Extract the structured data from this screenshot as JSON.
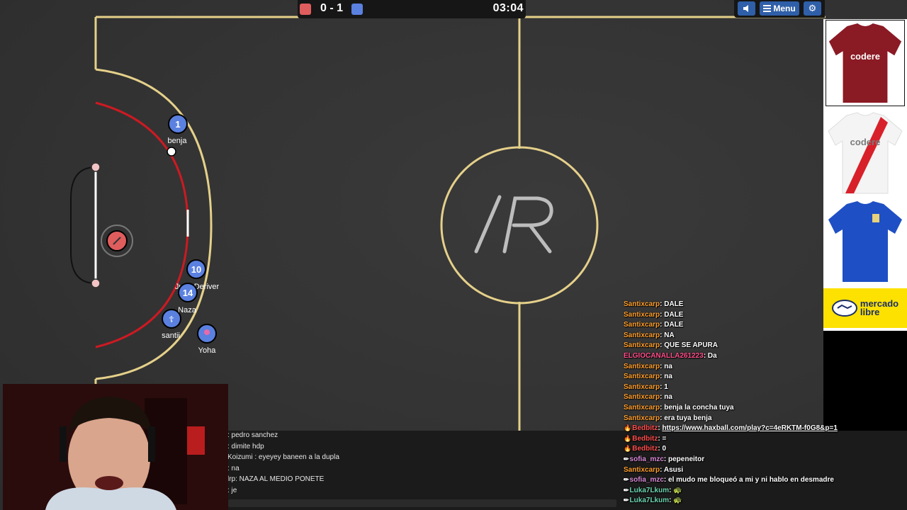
{
  "scoreboard": {
    "score": "0 - 1",
    "timer": "03:04",
    "red_color": "#e05d5d",
    "blue_color": "#5a80e0"
  },
  "top_menu": {
    "sound_icon": "speaker-icon",
    "menu_label": "Menu",
    "menu_icon": "hamburger-icon",
    "settings_icon": "gear-icon"
  },
  "field": {
    "center_logo": "/R"
  },
  "players": [
    {
      "team": "blue",
      "number": "1",
      "name": "benja"
    },
    {
      "team": "blue",
      "number": "10",
      "name": "Juan Deriver"
    },
    {
      "team": "blue",
      "number": "14",
      "name": "Naza"
    },
    {
      "team": "blue",
      "number": "",
      "name": "santii"
    },
    {
      "team": "blue",
      "number": "",
      "name": "Yoha"
    },
    {
      "team": "red",
      "number": "",
      "name": ""
    }
  ],
  "sponsors": {
    "brand": "mercado\nlibre",
    "jersey_text": "codere"
  },
  "game_chat": [
    {
      "text": ": pedro sanchez"
    },
    {
      "text": ": dimite hdp"
    },
    {
      "text": "Koizumi : eyeyey baneen a la dupla"
    },
    {
      "text": ": na"
    },
    {
      "text": "lrp: NAZA AL MEDIO PONETE"
    },
    {
      "text": ": je"
    }
  ],
  "stream_chat": [
    {
      "user": "Santixcarp",
      "msg": "DALE",
      "color": "#ff9f2e",
      "badge": ""
    },
    {
      "user": "Santixcarp",
      "msg": "DALE",
      "color": "#ff9f2e",
      "badge": ""
    },
    {
      "user": "Santixcarp",
      "msg": "DALE",
      "color": "#ff9f2e",
      "badge": ""
    },
    {
      "user": "Santixcarp",
      "msg": "NA",
      "color": "#ff9f2e",
      "badge": ""
    },
    {
      "user": "Santixcarp",
      "msg": "QUE SE APURA",
      "color": "#ff9f2e",
      "badge": ""
    },
    {
      "user": "ELGIOCANALLA261223",
      "msg": "Da",
      "color": "#ff4d8a",
      "badge": ""
    },
    {
      "user": "Santixcarp",
      "msg": "na",
      "color": "#ff9f2e",
      "badge": ""
    },
    {
      "user": "Santixcarp",
      "msg": "na",
      "color": "#ff9f2e",
      "badge": ""
    },
    {
      "user": "Santixcarp",
      "msg": "1",
      "color": "#ff9f2e",
      "badge": ""
    },
    {
      "user": "Santixcarp",
      "msg": "na",
      "color": "#ff9f2e",
      "badge": ""
    },
    {
      "user": "Santixcarp",
      "msg": "benja la concha tuya",
      "color": "#ff9f2e",
      "badge": ""
    },
    {
      "user": "Santixcarp",
      "msg": "era tuya benja",
      "color": "#ff9f2e",
      "badge": ""
    },
    {
      "user": "Bedbitz",
      "msg": "https://www.haxball.com/play?c=4eRKTM-f0G8&p=1",
      "color": "#ff4d4d",
      "badge": "🔥"
    },
    {
      "user": "Bedbitz",
      "msg": "=",
      "color": "#ff4d4d",
      "badge": "🔥"
    },
    {
      "user": "Bedbitz",
      "msg": "0",
      "color": "#ff4d4d",
      "badge": "🔥"
    },
    {
      "user": "sofia_mzc",
      "msg": "pepeneitor",
      "color": "#d88ad8",
      "badge": "✏"
    },
    {
      "user": "Santixcarp",
      "msg": "Asusi",
      "color": "#ff9f2e",
      "badge": ""
    },
    {
      "user": "sofia_mzc",
      "msg": "el mudo me bloqueó a mi y ni hablo en desmadre",
      "color": "#d88ad8",
      "badge": "✏"
    },
    {
      "user": "Luka7Lkum",
      "msg": "🐢",
      "color": "#6cd6b0",
      "badge": "✏"
    },
    {
      "user": "Luka7Lkum",
      "msg": "🐢",
      "color": "#6cd6b0",
      "badge": "✏"
    }
  ],
  "webcam": {
    "label": "webcam"
  }
}
